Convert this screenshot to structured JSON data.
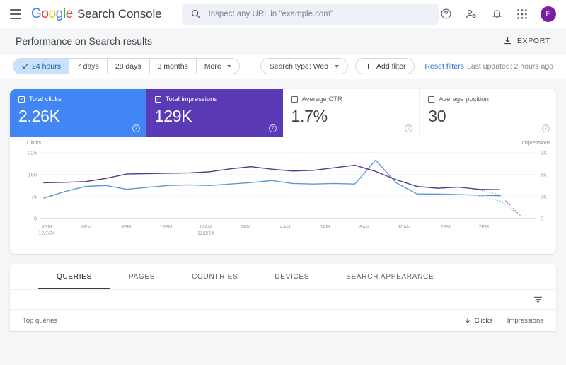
{
  "appbar": {
    "menu_icon": "hamburger-icon",
    "logo_word": "Google",
    "product_name": "Search Console",
    "search": {
      "placeholder": "Inspect any URL in \"example.com\"",
      "value": "",
      "icon": "search-icon"
    },
    "help_icon": "help-circle-icon",
    "users_icon": "users-icon",
    "notifications_icon": "bell-icon",
    "apps_icon": "apps-grid-icon",
    "avatar_initial": "E"
  },
  "header": {
    "title": "Performance on Search results",
    "export_label": "EXPORT",
    "export_icon": "download-icon"
  },
  "filterbar": {
    "date_chips": [
      {
        "label": "24 hours",
        "active": true
      },
      {
        "label": "7 days",
        "active": false
      },
      {
        "label": "28 days",
        "active": false
      },
      {
        "label": "3 months",
        "active": false
      },
      {
        "label": "More",
        "active": false
      }
    ],
    "search_type": "Search type: Web",
    "add_filter": "Add filter",
    "reset_filters": "Reset filters",
    "last_updated": "Last updated: 2 hours ago"
  },
  "metrics": [
    {
      "label": "Total clicks",
      "value": "2.26K",
      "checked": true,
      "color": "#4285F4"
    },
    {
      "label": "Total impressions",
      "value": "129K",
      "checked": true,
      "color": "#5a3ab5"
    },
    {
      "label": "Average CTR",
      "value": "1.7%",
      "checked": false,
      "color": "#ffffff"
    },
    {
      "label": "Average position",
      "value": "30",
      "checked": false,
      "color": "#ffffff"
    }
  ],
  "chart_data": {
    "type": "line",
    "title": "",
    "xlabel": "",
    "ylabel": "Clicks",
    "y2label": "Impressions",
    "grid": true,
    "legend": "none",
    "ylim": [
      0,
      225
    ],
    "y2lim": [
      0,
      9000
    ],
    "yticks": [
      "0",
      "75",
      "150",
      "225"
    ],
    "y2ticks": [
      "0",
      "3K",
      "6K",
      "9K"
    ],
    "x_tick_labels": [
      "4PM",
      "6PM",
      "8PM",
      "10PM",
      "12AM",
      "2AM",
      "4AM",
      "6AM",
      "8AM",
      "10AM",
      "12PM",
      "2PM"
    ],
    "x_tick_sublabels": [
      "12/7/24",
      "",
      "",
      "",
      "12/8/24",
      "",
      "",
      "",
      "",
      "",
      "",
      ""
    ],
    "x": [
      "4PM",
      "5PM",
      "6PM",
      "7PM",
      "8PM",
      "9PM",
      "10PM",
      "11PM",
      "12AM",
      "1AM",
      "2AM",
      "3AM",
      "4AM",
      "5AM",
      "6AM",
      "7AM",
      "8AM",
      "9AM",
      "10AM",
      "11AM",
      "12PM",
      "1PM",
      "2PM",
      "3PM"
    ],
    "series": [
      {
        "name": "Clicks",
        "color": "#5b9bd5",
        "axis": "left",
        "values": [
          70,
          92,
          110,
          113,
          100,
          107,
          113,
          115,
          113,
          118,
          123,
          130,
          120,
          118,
          120,
          118,
          200,
          122,
          84,
          84,
          82,
          80,
          78,
          null
        ],
        "projected_values": [
          null,
          null,
          null,
          null,
          null,
          null,
          null,
          null,
          null,
          null,
          null,
          null,
          null,
          null,
          null,
          null,
          null,
          null,
          null,
          null,
          null,
          78,
          60,
          10
        ]
      },
      {
        "name": "Impressions",
        "color": "#5b3a8c",
        "axis": "right",
        "values": [
          4900,
          4950,
          5050,
          5500,
          6100,
          6150,
          6200,
          6250,
          6400,
          6800,
          7100,
          6750,
          6500,
          6600,
          6950,
          7300,
          6450,
          5300,
          4400,
          4150,
          4300,
          4000,
          3950,
          null
        ],
        "projected_values": [
          null,
          null,
          null,
          null,
          null,
          null,
          null,
          null,
          null,
          null,
          null,
          null,
          null,
          null,
          null,
          null,
          null,
          null,
          null,
          null,
          null,
          3950,
          3200,
          350
        ]
      }
    ]
  },
  "tabs": [
    {
      "label": "QUERIES",
      "active": true
    },
    {
      "label": "PAGES",
      "active": false
    },
    {
      "label": "COUNTRIES",
      "active": false
    },
    {
      "label": "DEVICES",
      "active": false
    },
    {
      "label": "SEARCH APPEARANCE",
      "active": false
    }
  ],
  "table": {
    "filter_icon": "filter-list-icon",
    "columns": {
      "queries": "Top queries",
      "clicks": "Clicks",
      "clicks_sort_icon": "arrow-down-icon",
      "impressions": "Impressions"
    },
    "rows": []
  }
}
